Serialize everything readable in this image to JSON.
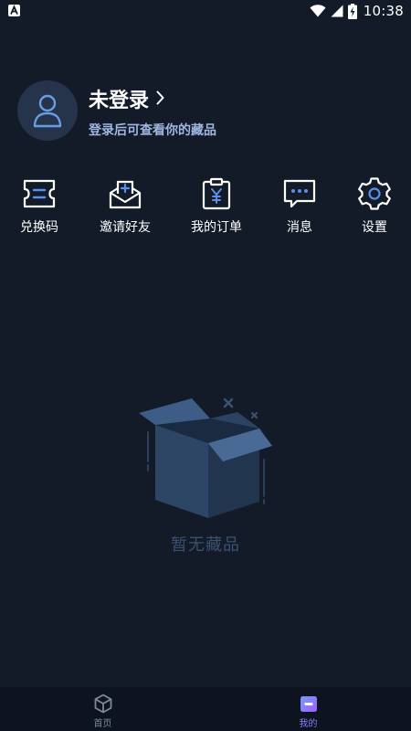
{
  "status_bar": {
    "time": "10:38",
    "icons": [
      "app-notification-icon",
      "wifi-icon",
      "cellular-signal-icon",
      "battery-charging-icon"
    ]
  },
  "profile": {
    "title": "未登录",
    "subtitle": "登录后可查看你的藏品",
    "avatar_icon": "user-icon"
  },
  "actions": [
    {
      "label": "兑换码",
      "icon": "ticket-icon"
    },
    {
      "label": "邀请好友",
      "icon": "invite-mail-icon"
    },
    {
      "label": "我的订单",
      "icon": "order-clipboard-icon"
    },
    {
      "label": "消息",
      "icon": "message-bubble-icon"
    },
    {
      "label": "设置",
      "icon": "gear-icon"
    }
  ],
  "empty_state": {
    "text": "暂无藏品",
    "icon": "empty-box-icon"
  },
  "bottom_nav": {
    "items": [
      {
        "label": "首页",
        "icon": "cube-home-icon",
        "active": false
      },
      {
        "label": "我的",
        "icon": "profile-card-icon",
        "active": true
      }
    ]
  },
  "colors": {
    "background": "#131b29",
    "accent_subtitle": "#9fb6e2",
    "icon_blue": "#5b8fe8",
    "nav_active": "#8a7cff",
    "nav_inactive": "#7d889a"
  }
}
